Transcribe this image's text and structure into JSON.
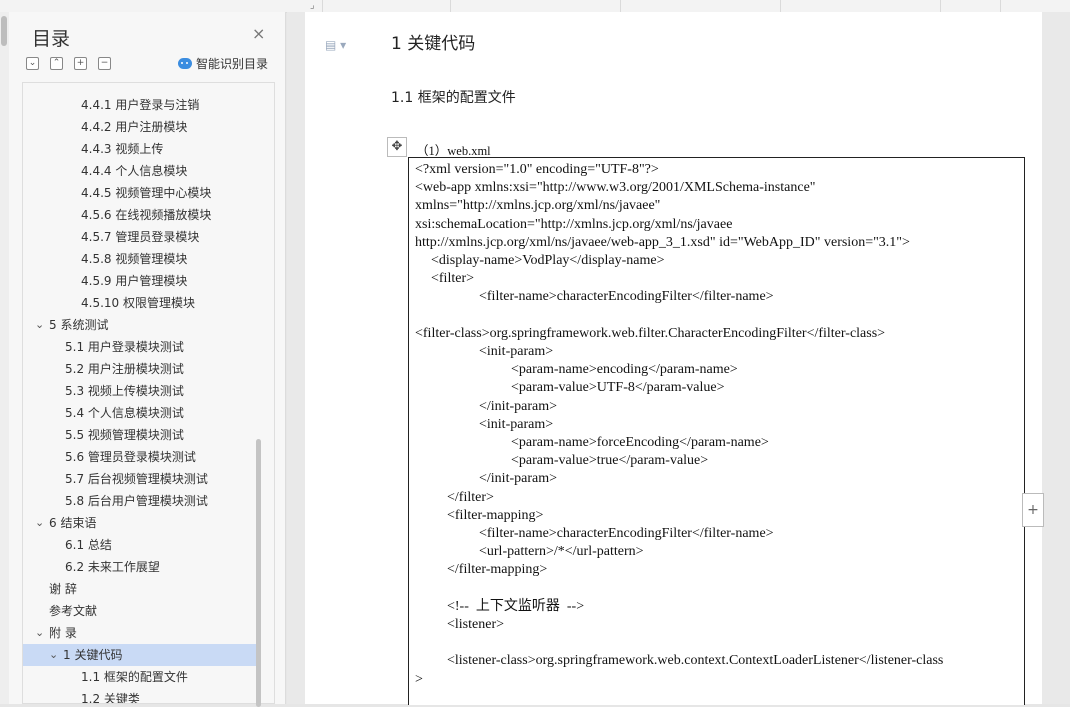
{
  "sidebar": {
    "title": "目录",
    "close_icon": "×",
    "tools": [
      "⌄",
      "⌃",
      "+",
      "−"
    ],
    "smart_label": "智能识别目录",
    "items": [
      {
        "label": "4.4.1 用户登录与注销",
        "level": 3
      },
      {
        "label": "4.4.2 用户注册模块",
        "level": 3
      },
      {
        "label": "4.4.3 视频上传",
        "level": 3
      },
      {
        "label": "4.4.4 个人信息模块",
        "level": 3
      },
      {
        "label": "4.4.5 视频管理中心模块",
        "level": 3
      },
      {
        "label": "4.5.6 在线视频播放模块",
        "level": 3
      },
      {
        "label": "4.5.7 管理员登录模块",
        "level": 3
      },
      {
        "label": "4.5.8 视频管理模块",
        "level": 3
      },
      {
        "label": "4.5.9 用户管理模块",
        "level": 3
      },
      {
        "label": "4.5.10  权限管理模块",
        "level": 3
      },
      {
        "label": "5   系统测试",
        "level": 1,
        "arrow": "⌄"
      },
      {
        "label": "5.1 用户登录模块测试",
        "level": 2
      },
      {
        "label": "5.2 用户注册模块测试",
        "level": 2
      },
      {
        "label": "5.3 视频上传模块测试",
        "level": 2
      },
      {
        "label": "5.4 个人信息模块测试",
        "level": 2
      },
      {
        "label": "5.5 视频管理模块测试",
        "level": 2
      },
      {
        "label": "5.6 管理员登录模块测试",
        "level": 2
      },
      {
        "label": "5.7 后台视频管理模块测试",
        "level": 2
      },
      {
        "label": "5.8 后台用户管理模块测试",
        "level": 2
      },
      {
        "label": "6   结束语",
        "level": 1,
        "arrow": "⌄"
      },
      {
        "label": "6.1 总结",
        "level": 2
      },
      {
        "label": "6.2 未来工作展望",
        "level": 2
      },
      {
        "label": "谢  辞",
        "level": 0
      },
      {
        "label": "参考文献",
        "level": 0
      },
      {
        "label": "附  录",
        "level": 1,
        "arrow": "⌄"
      },
      {
        "label": "1 关键代码",
        "level": 1.5,
        "arrow": "⌄",
        "selected": true
      },
      {
        "label": "1.1 框架的配置文件",
        "level": 3
      },
      {
        "label": "1.2  关键类",
        "level": 3
      }
    ]
  },
  "document": {
    "heading1": "1 关键代码",
    "heading2": "1.1 框架的配置文件",
    "caption": "（1）web.xml",
    "code_lines": [
      {
        "text": "<?xml version=\"1.0\" encoding=\"UTF-8\"?>",
        "indent": 0
      },
      {
        "text": "<web-app xmlns:xsi=\"http://www.w3.org/2001/XMLSchema-instance\"",
        "indent": 0
      },
      {
        "text": "xmlns=\"http://xmlns.jcp.org/xml/ns/javaee\"",
        "indent": 0
      },
      {
        "text": "xsi:schemaLocation=\"http://xmlns.jcp.org/xml/ns/javaee",
        "indent": 0
      },
      {
        "text": "http://xmlns.jcp.org/xml/ns/javaee/web-app_3_1.xsd\" id=\"WebApp_ID\" version=\"3.1\">",
        "indent": 0
      },
      {
        "text": "<display-name>VodPlay</display-name>",
        "indent": 1
      },
      {
        "text": "<filter>",
        "indent": 1
      },
      {
        "text": "<filter-name>characterEncodingFilter</filter-name>",
        "indent": 4
      },
      {
        "text": "",
        "indent": 0
      },
      {
        "text": "<filter-class>org.springframework.web.filter.CharacterEncodingFilter</filter-class>",
        "indent": 0
      },
      {
        "text": "<init-param>",
        "indent": 4
      },
      {
        "text": "<param-name>encoding</param-name>",
        "indent": 6
      },
      {
        "text": "<param-value>UTF-8</param-value>",
        "indent": 6
      },
      {
        "text": "</init-param>",
        "indent": 4
      },
      {
        "text": "<init-param>",
        "indent": 4
      },
      {
        "text": "<param-name>forceEncoding</param-name>",
        "indent": 6
      },
      {
        "text": "<param-value>true</param-value>",
        "indent": 6
      },
      {
        "text": "</init-param>",
        "indent": 4
      },
      {
        "text": "</filter>",
        "indent": 2
      },
      {
        "text": "<filter-mapping>",
        "indent": 2
      },
      {
        "text": "<filter-name>characterEncodingFilter</filter-name>",
        "indent": 4
      },
      {
        "text": "<url-pattern>/*</url-pattern>",
        "indent": 4
      },
      {
        "text": "</filter-mapping>",
        "indent": 2
      },
      {
        "text": "",
        "indent": 0
      },
      {
        "text": "<!--  上下文监听器  -->",
        "indent": 2
      },
      {
        "text": "<listener>",
        "indent": 2
      },
      {
        "text": "",
        "indent": 0
      },
      {
        "text": "<listener-class>org.springframework.web.context.ContextLoaderListener</listener-class",
        "indent": 2
      },
      {
        "text": ">",
        "indent": 0
      }
    ]
  },
  "right_add_button": "+",
  "move_handle": "✥",
  "doc_icon": "▤ ▾"
}
